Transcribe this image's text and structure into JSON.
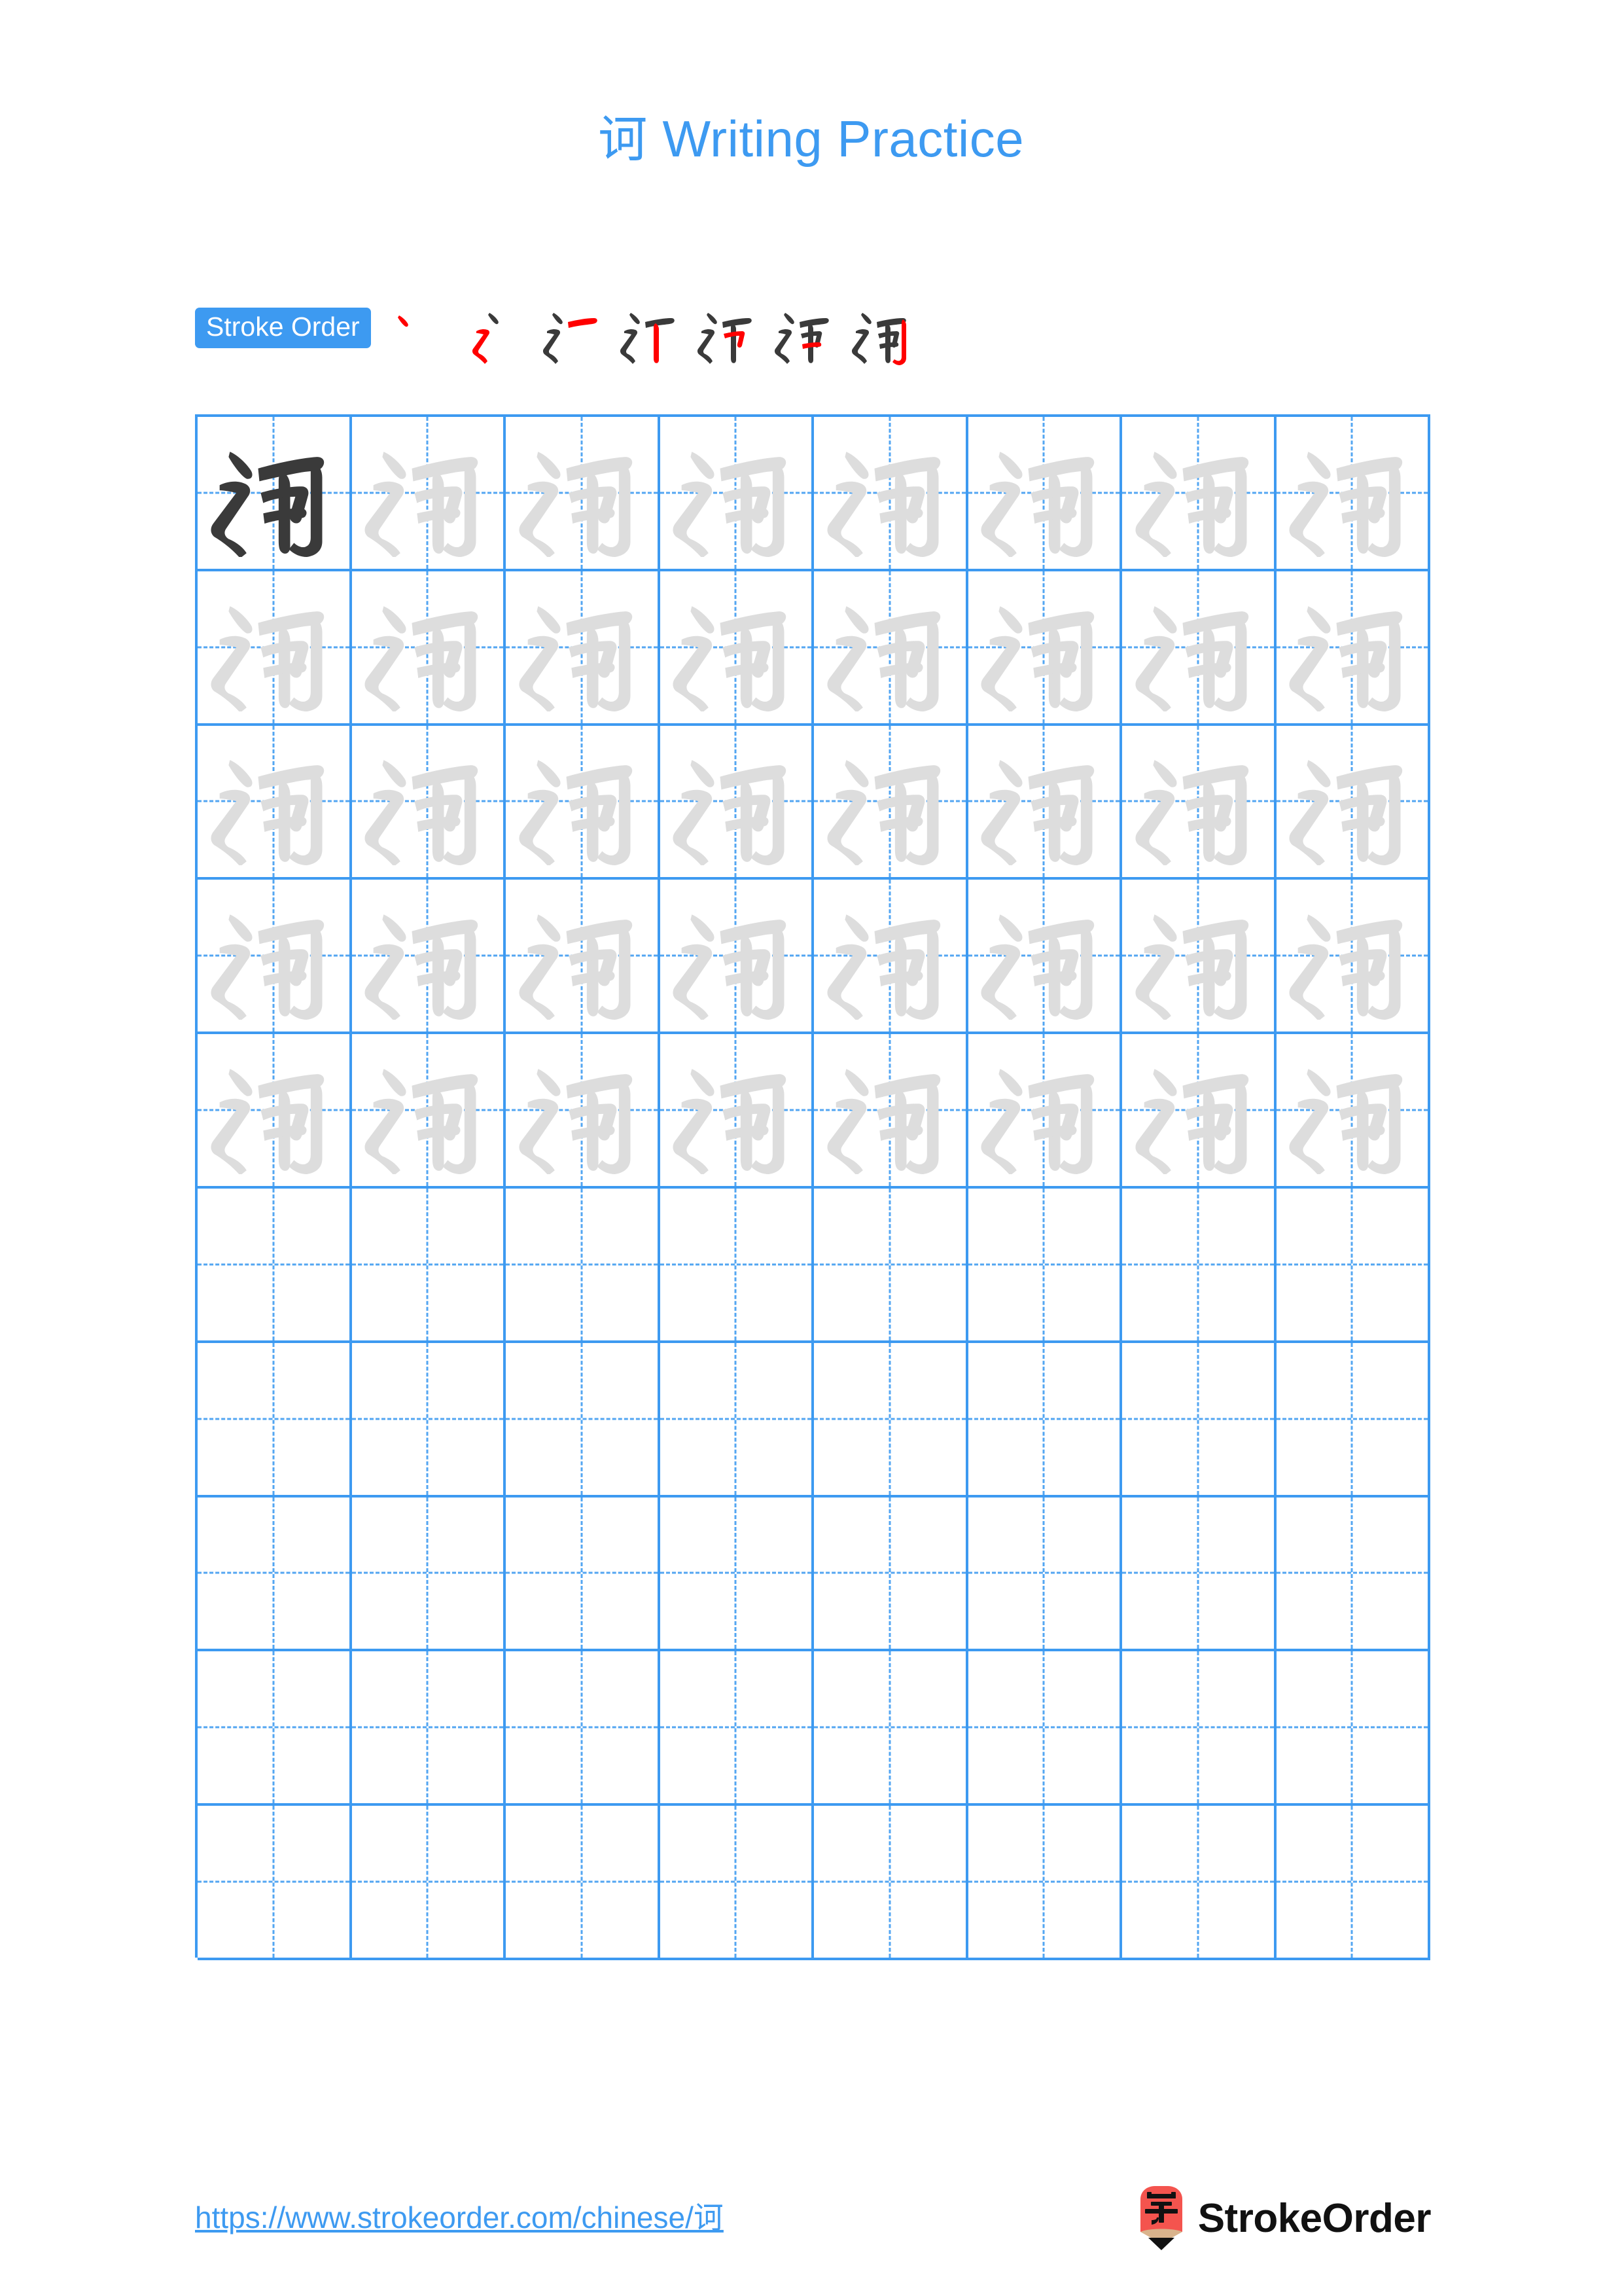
{
  "page": {
    "character": "诃",
    "title_text": "诃 Writing Practice",
    "title_suffix": " Writing Practice",
    "accent_color": "#3d9af1",
    "grid_line_color": "#3d9af1",
    "model_glyph_color": "#3a3a3a",
    "trace_glyph_color": "#dddddd",
    "new_stroke_color": "#ff0000",
    "prev_stroke_color": "#3a3a3a",
    "background_color": "#ffffff"
  },
  "stroke_order": {
    "badge_label": "Stroke Order",
    "total_strokes": 7,
    "steps": [
      {
        "index": 1,
        "strokes_shown": 1,
        "new_stroke_name": "dian-dot"
      },
      {
        "index": 2,
        "strokes_shown": 2,
        "new_stroke_name": "hengzhe-tipie"
      },
      {
        "index": 3,
        "strokes_shown": 3,
        "new_stroke_name": "heng"
      },
      {
        "index": 4,
        "strokes_shown": 4,
        "new_stroke_name": "shu"
      },
      {
        "index": 5,
        "strokes_shown": 5,
        "new_stroke_name": "heng-zhe"
      },
      {
        "index": 6,
        "strokes_shown": 6,
        "new_stroke_name": "heng"
      },
      {
        "index": 7,
        "strokes_shown": 7,
        "new_stroke_name": "shu-gou"
      }
    ]
  },
  "grid": {
    "columns": 8,
    "rows": 10,
    "filled_rows": 5,
    "empty_rows": 5,
    "cells": [
      [
        "dark",
        "light",
        "light",
        "light",
        "light",
        "light",
        "light",
        "light"
      ],
      [
        "light",
        "light",
        "light",
        "light",
        "light",
        "light",
        "light",
        "light"
      ],
      [
        "light",
        "light",
        "light",
        "light",
        "light",
        "light",
        "light",
        "light"
      ],
      [
        "light",
        "light",
        "light",
        "light",
        "light",
        "light",
        "light",
        "light"
      ],
      [
        "light",
        "light",
        "light",
        "light",
        "light",
        "light",
        "light",
        "light"
      ],
      [
        "empty",
        "empty",
        "empty",
        "empty",
        "empty",
        "empty",
        "empty",
        "empty"
      ],
      [
        "empty",
        "empty",
        "empty",
        "empty",
        "empty",
        "empty",
        "empty",
        "empty"
      ],
      [
        "empty",
        "empty",
        "empty",
        "empty",
        "empty",
        "empty",
        "empty",
        "empty"
      ],
      [
        "empty",
        "empty",
        "empty",
        "empty",
        "empty",
        "empty",
        "empty",
        "empty"
      ],
      [
        "empty",
        "empty",
        "empty",
        "empty",
        "empty",
        "empty",
        "empty",
        "empty"
      ]
    ]
  },
  "footer": {
    "url": "https://www.strokeorder.com/chinese/诃",
    "logo_text": "StrokeOrder",
    "logo_mark_char": "字",
    "logo_mark_color": "#f4544e",
    "logo_mark_wood_color": "#d9b38c",
    "logo_mark_tip_color": "#111111"
  }
}
